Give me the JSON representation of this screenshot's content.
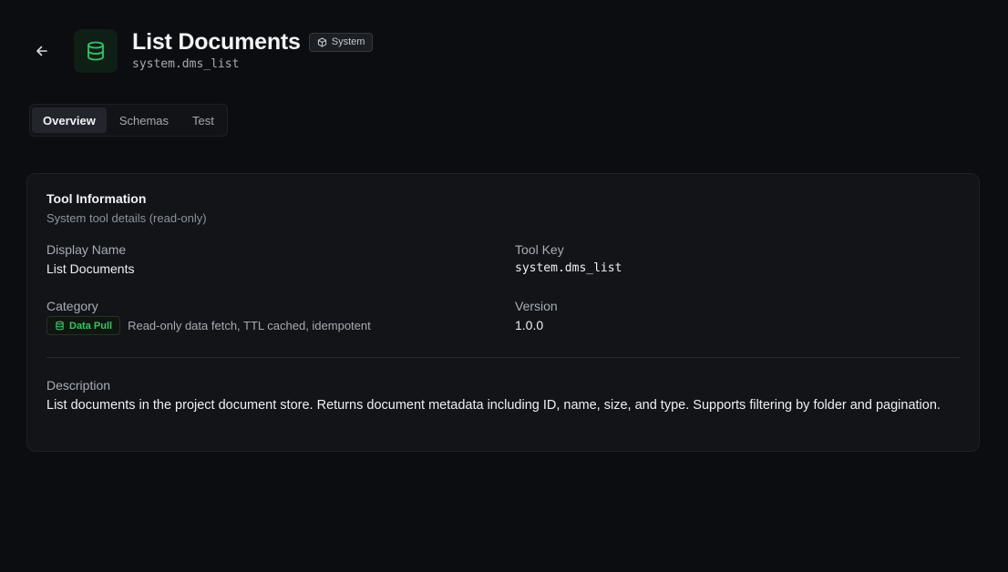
{
  "header": {
    "title": "List Documents",
    "badge": "System",
    "tool_key": "system.dms_list",
    "back_icon": "arrow-left-icon",
    "tool_icon": "database-icon"
  },
  "tabs": [
    {
      "label": "Overview",
      "active": true
    },
    {
      "label": "Schemas",
      "active": false
    },
    {
      "label": "Test",
      "active": false
    }
  ],
  "card": {
    "title": "Tool Information",
    "subtitle": "System tool details (read-only)",
    "display_name_label": "Display Name",
    "display_name": "List Documents",
    "tool_key_label": "Tool Key",
    "tool_key": "system.dms_list",
    "category_label": "Category",
    "category_badge": "Data Pull",
    "category_desc": "Read-only data fetch, TTL cached, idempotent",
    "version_label": "Version",
    "version": "1.0.0",
    "description_label": "Description",
    "description": "List documents in the project document store. Returns document metadata including ID, name, size, and type. Supports filtering by folder and pagination."
  },
  "colors": {
    "background": "#0c0d10",
    "card": "#121418",
    "accent_green": "#2ec866"
  }
}
